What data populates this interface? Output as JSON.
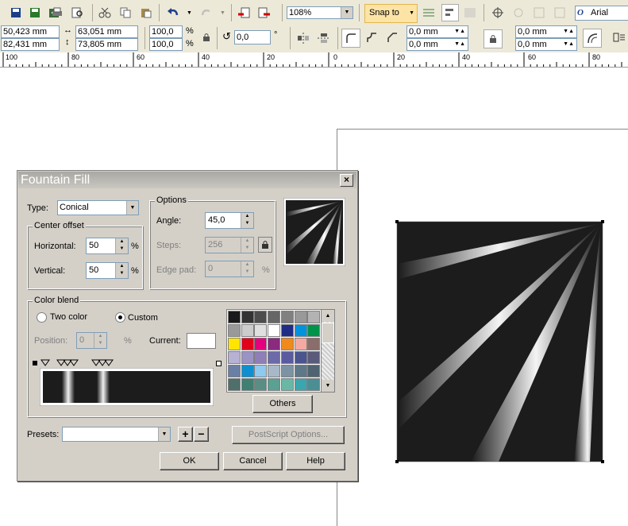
{
  "toolbar1": {
    "zoom": "108%",
    "snap_to": "Snap to",
    "font": "Arial",
    "font_glyph": "O"
  },
  "toolbar2": {
    "x": "50,423 mm",
    "y": "82,431 mm",
    "width": "63,051 mm",
    "height": "73,805 mm",
    "scale_x": "100,0",
    "scale_y": "100,0",
    "pct": "%",
    "angle": "0,0",
    "deg": "°",
    "corner1": "0,0 mm",
    "corner2": "0,0 mm",
    "corner3": "0,0 mm",
    "corner4": "0,0 mm"
  },
  "ruler": {
    "labels": [
      "100",
      "80",
      "60",
      "40",
      "20",
      "0",
      "20",
      "40",
      "60",
      "80"
    ]
  },
  "dialog": {
    "title": "Fountain Fill",
    "close": "×",
    "type_label": "Type:",
    "type_value": "Conical",
    "center_offset": {
      "title": "Center offset",
      "horizontal_label": "Horizontal:",
      "horizontal_value": "50",
      "vertical_label": "Vertical:",
      "vertical_value": "50",
      "pct": "%"
    },
    "options": {
      "title": "Options",
      "angle_label": "Angle:",
      "angle_value": "45,0",
      "steps_label": "Steps:",
      "steps_value": "256",
      "edge_pad_label": "Edge pad:",
      "edge_pad_value": "0",
      "pct": "%"
    },
    "color_blend": {
      "title": "Color blend",
      "two_color": "Two color",
      "custom": "Custom",
      "position_label": "Position:",
      "position_value": "0",
      "pct": "%",
      "current_label": "Current:",
      "others": "Others"
    },
    "palette": [
      "#1a1a1a",
      "#333333",
      "#4d4d4d",
      "#666666",
      "#808080",
      "#999999",
      "#b3b3b3",
      "#999999",
      "#cccccc",
      "#e0e0e0",
      "#ffffff",
      "#1f2d86",
      "#0093dd",
      "#00934a",
      "#ffe500",
      "#e3001b",
      "#e5007e",
      "#8c2a80",
      "#f08a1d",
      "#f4a9a1",
      "#8a6e6b",
      "#b7b1d4",
      "#9a93c4",
      "#8f7eb8",
      "#6d6aa9",
      "#5a5aa1",
      "#4a548f",
      "#5a5a7a",
      "#6a7fa6",
      "#0f8fd0",
      "#8fc9ee",
      "#a8b8c8",
      "#7c93a4",
      "#5e7887",
      "#4f6470",
      "#4f6f6a",
      "#3f8073",
      "#5a8e84",
      "#5aa093",
      "#69b7a5",
      "#3aa6b0",
      "#4b8f94"
    ],
    "presets_label": "Presets:",
    "presets_value": "",
    "postscript": "PostScript Options...",
    "ok": "OK",
    "cancel": "Cancel",
    "help": "Help"
  }
}
